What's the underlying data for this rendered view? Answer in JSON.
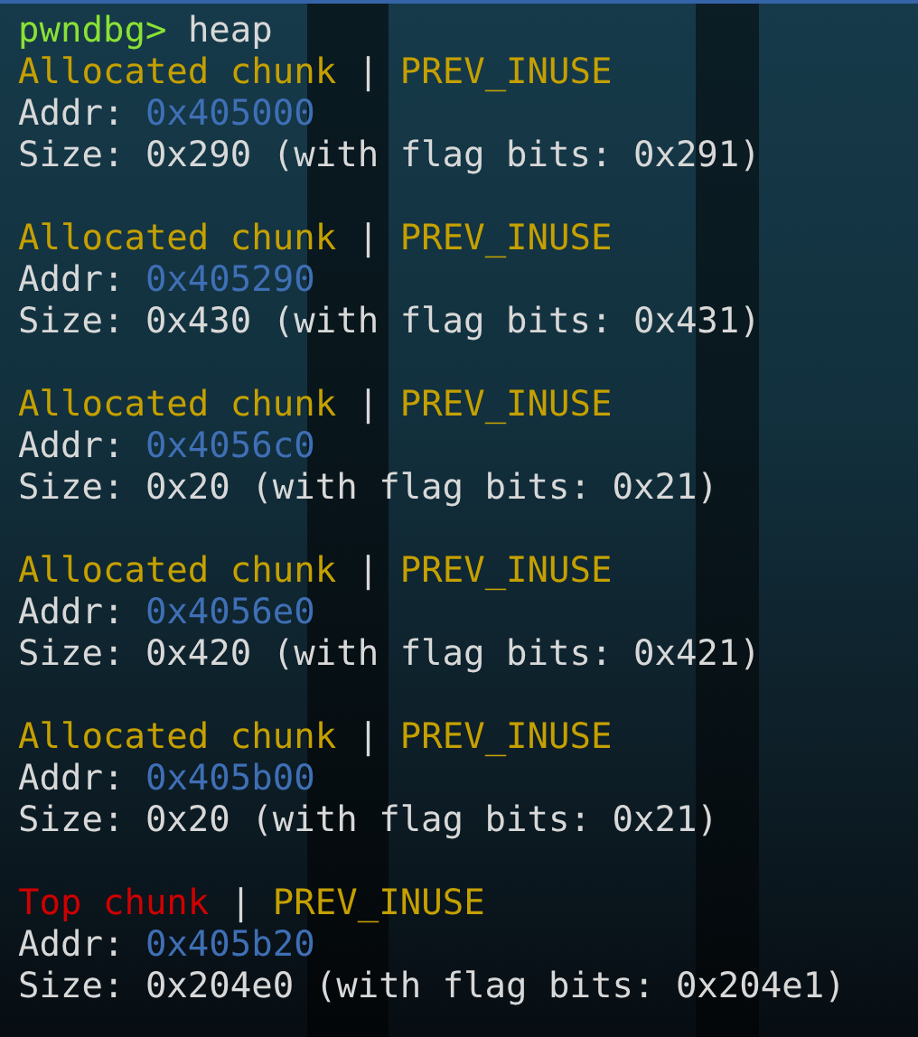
{
  "terminal": {
    "prompt": "pwndbg>",
    "command": "heap",
    "chunks": [
      {
        "kind": "allocated",
        "name": "Allocated chunk",
        "separator": "|",
        "flag": "PREV_INUSE",
        "addr_label": "Addr:",
        "addr": "0x405000",
        "size": "Size: 0x290 (with flag bits: 0x291)"
      },
      {
        "kind": "allocated",
        "name": "Allocated chunk",
        "separator": "|",
        "flag": "PREV_INUSE",
        "addr_label": "Addr:",
        "addr": "0x405290",
        "size": "Size: 0x430 (with flag bits: 0x431)"
      },
      {
        "kind": "allocated",
        "name": "Allocated chunk",
        "separator": "|",
        "flag": "PREV_INUSE",
        "addr_label": "Addr:",
        "addr": "0x4056c0",
        "size": "Size: 0x20 (with flag bits: 0x21)"
      },
      {
        "kind": "allocated",
        "name": "Allocated chunk",
        "separator": "|",
        "flag": "PREV_INUSE",
        "addr_label": "Addr:",
        "addr": "0x4056e0",
        "size": "Size: 0x420 (with flag bits: 0x421)"
      },
      {
        "kind": "allocated",
        "name": "Allocated chunk",
        "separator": "|",
        "flag": "PREV_INUSE",
        "addr_label": "Addr:",
        "addr": "0x405b00",
        "size": "Size: 0x20 (with flag bits: 0x21)"
      },
      {
        "kind": "top",
        "name": "Top chunk",
        "separator": "|",
        "flag": "PREV_INUSE",
        "addr_label": "Addr:",
        "addr": "0x405b20",
        "size": "Size: 0x204e0 (with flag bits: 0x204e1)"
      }
    ]
  }
}
